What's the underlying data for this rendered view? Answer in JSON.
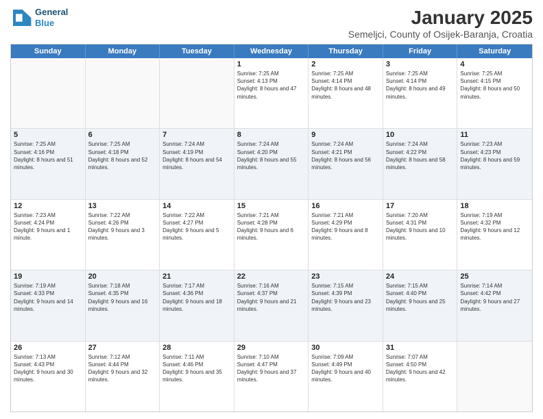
{
  "logo": {
    "line1": "General",
    "line2": "Blue"
  },
  "title": "January 2025",
  "subtitle": "Semeljci, County of Osijek-Baranja, Croatia",
  "days": [
    "Sunday",
    "Monday",
    "Tuesday",
    "Wednesday",
    "Thursday",
    "Friday",
    "Saturday"
  ],
  "weeks": [
    [
      {
        "day": "",
        "info": ""
      },
      {
        "day": "",
        "info": ""
      },
      {
        "day": "",
        "info": ""
      },
      {
        "day": "1",
        "info": "Sunrise: 7:25 AM\nSunset: 4:13 PM\nDaylight: 8 hours and 47 minutes."
      },
      {
        "day": "2",
        "info": "Sunrise: 7:25 AM\nSunset: 4:14 PM\nDaylight: 8 hours and 48 minutes."
      },
      {
        "day": "3",
        "info": "Sunrise: 7:25 AM\nSunset: 4:14 PM\nDaylight: 8 hours and 49 minutes."
      },
      {
        "day": "4",
        "info": "Sunrise: 7:25 AM\nSunset: 4:15 PM\nDaylight: 8 hours and 50 minutes."
      }
    ],
    [
      {
        "day": "5",
        "info": "Sunrise: 7:25 AM\nSunset: 4:16 PM\nDaylight: 8 hours and 51 minutes."
      },
      {
        "day": "6",
        "info": "Sunrise: 7:25 AM\nSunset: 4:18 PM\nDaylight: 8 hours and 52 minutes."
      },
      {
        "day": "7",
        "info": "Sunrise: 7:24 AM\nSunset: 4:19 PM\nDaylight: 8 hours and 54 minutes."
      },
      {
        "day": "8",
        "info": "Sunrise: 7:24 AM\nSunset: 4:20 PM\nDaylight: 8 hours and 55 minutes."
      },
      {
        "day": "9",
        "info": "Sunrise: 7:24 AM\nSunset: 4:21 PM\nDaylight: 8 hours and 56 minutes."
      },
      {
        "day": "10",
        "info": "Sunrise: 7:24 AM\nSunset: 4:22 PM\nDaylight: 8 hours and 58 minutes."
      },
      {
        "day": "11",
        "info": "Sunrise: 7:23 AM\nSunset: 4:23 PM\nDaylight: 8 hours and 59 minutes."
      }
    ],
    [
      {
        "day": "12",
        "info": "Sunrise: 7:23 AM\nSunset: 4:24 PM\nDaylight: 9 hours and 1 minute."
      },
      {
        "day": "13",
        "info": "Sunrise: 7:22 AM\nSunset: 4:26 PM\nDaylight: 9 hours and 3 minutes."
      },
      {
        "day": "14",
        "info": "Sunrise: 7:22 AM\nSunset: 4:27 PM\nDaylight: 9 hours and 5 minutes."
      },
      {
        "day": "15",
        "info": "Sunrise: 7:21 AM\nSunset: 4:28 PM\nDaylight: 9 hours and 6 minutes."
      },
      {
        "day": "16",
        "info": "Sunrise: 7:21 AM\nSunset: 4:29 PM\nDaylight: 9 hours and 8 minutes."
      },
      {
        "day": "17",
        "info": "Sunrise: 7:20 AM\nSunset: 4:31 PM\nDaylight: 9 hours and 10 minutes."
      },
      {
        "day": "18",
        "info": "Sunrise: 7:19 AM\nSunset: 4:32 PM\nDaylight: 9 hours and 12 minutes."
      }
    ],
    [
      {
        "day": "19",
        "info": "Sunrise: 7:19 AM\nSunset: 4:33 PM\nDaylight: 9 hours and 14 minutes."
      },
      {
        "day": "20",
        "info": "Sunrise: 7:18 AM\nSunset: 4:35 PM\nDaylight: 9 hours and 16 minutes."
      },
      {
        "day": "21",
        "info": "Sunrise: 7:17 AM\nSunset: 4:36 PM\nDaylight: 9 hours and 18 minutes."
      },
      {
        "day": "22",
        "info": "Sunrise: 7:16 AM\nSunset: 4:37 PM\nDaylight: 9 hours and 21 minutes."
      },
      {
        "day": "23",
        "info": "Sunrise: 7:15 AM\nSunset: 4:39 PM\nDaylight: 9 hours and 23 minutes."
      },
      {
        "day": "24",
        "info": "Sunrise: 7:15 AM\nSunset: 4:40 PM\nDaylight: 9 hours and 25 minutes."
      },
      {
        "day": "25",
        "info": "Sunrise: 7:14 AM\nSunset: 4:42 PM\nDaylight: 9 hours and 27 minutes."
      }
    ],
    [
      {
        "day": "26",
        "info": "Sunrise: 7:13 AM\nSunset: 4:43 PM\nDaylight: 9 hours and 30 minutes."
      },
      {
        "day": "27",
        "info": "Sunrise: 7:12 AM\nSunset: 4:44 PM\nDaylight: 9 hours and 32 minutes."
      },
      {
        "day": "28",
        "info": "Sunrise: 7:11 AM\nSunset: 4:46 PM\nDaylight: 9 hours and 35 minutes."
      },
      {
        "day": "29",
        "info": "Sunrise: 7:10 AM\nSunset: 4:47 PM\nDaylight: 9 hours and 37 minutes."
      },
      {
        "day": "30",
        "info": "Sunrise: 7:09 AM\nSunset: 4:49 PM\nDaylight: 9 hours and 40 minutes."
      },
      {
        "day": "31",
        "info": "Sunrise: 7:07 AM\nSunset: 4:50 PM\nDaylight: 9 hours and 42 minutes."
      },
      {
        "day": "",
        "info": ""
      }
    ]
  ]
}
